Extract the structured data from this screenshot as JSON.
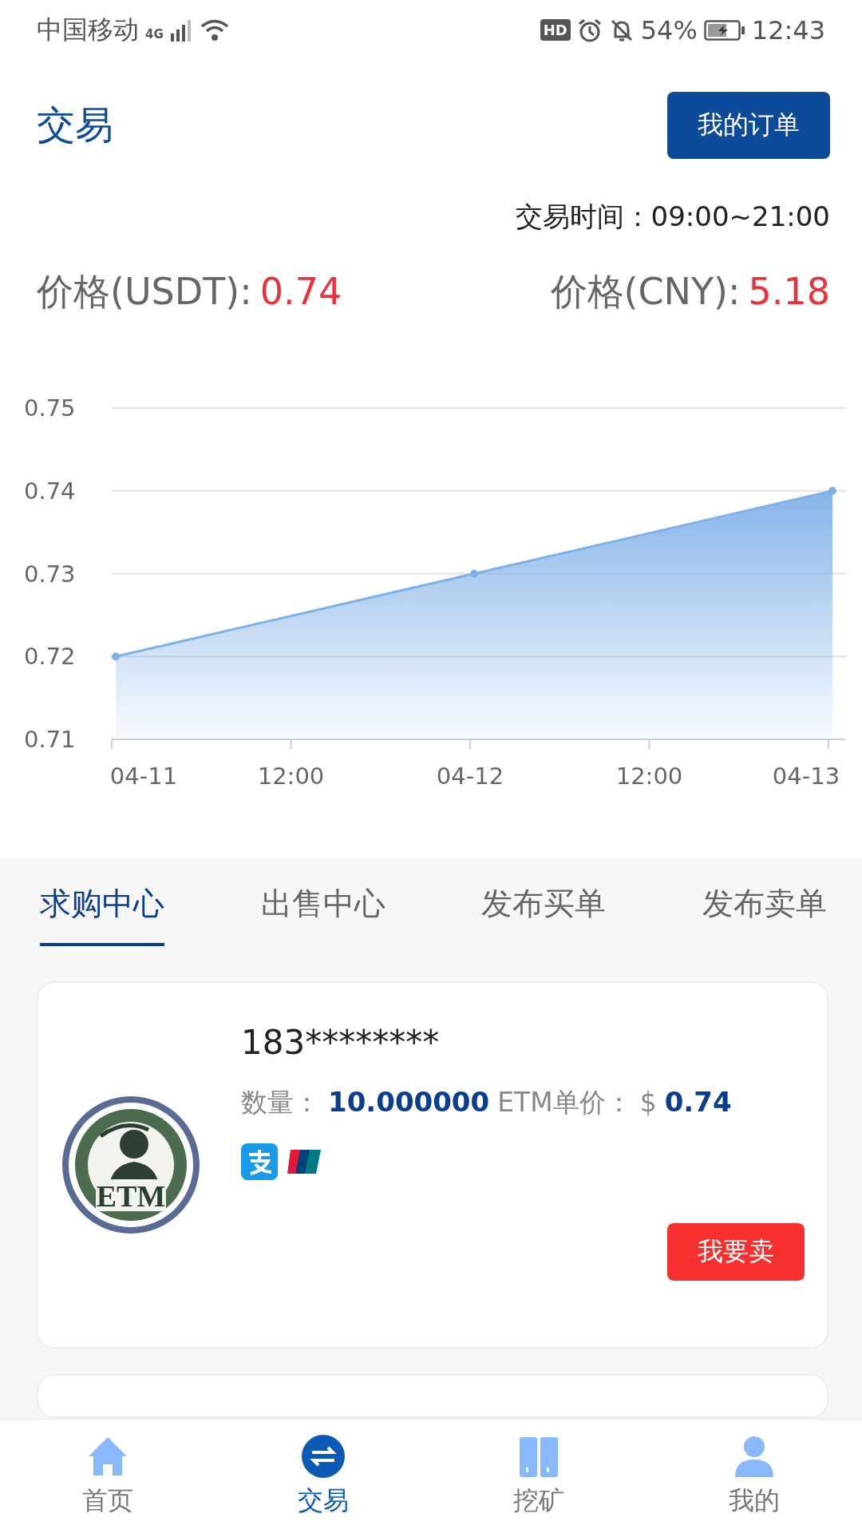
{
  "status_bar": {
    "carrier": "中国移动",
    "network": "4G",
    "hd": "HD",
    "battery": "54%",
    "time": "12:43"
  },
  "header": {
    "title": "交易",
    "orders_button": "我的订单"
  },
  "trade_hours": "交易时间：09:00~21:00",
  "prices": [
    {
      "label": "价格(USDT):",
      "value": "0.74"
    },
    {
      "label": "价格(CNY):",
      "value": "5.18"
    }
  ],
  "chart_data": {
    "type": "area",
    "categories": [
      "04-11",
      "12:00",
      "04-12",
      "12:00",
      "04-13"
    ],
    "series": [
      {
        "color": "#7fb0e8",
        "values": [
          0.72,
          null,
          0.73,
          null,
          0.74
        ]
      }
    ],
    "ylim": [
      0.71,
      0.75
    ],
    "yticks": [
      0.71,
      0.72,
      0.73,
      0.74,
      0.75
    ],
    "grid": true
  },
  "tabs": [
    {
      "label": "求购中心",
      "selected": true
    },
    {
      "label": "出售中心",
      "selected": false
    },
    {
      "label": "发布买单",
      "selected": false
    },
    {
      "label": "发布卖单",
      "selected": false
    }
  ],
  "orders": [
    {
      "user": "183********",
      "logo_text": "ETM",
      "qty_label": "数量：",
      "qty": "10.000000",
      "price_label": "ETM单价：",
      "currency": "$",
      "price": "0.74",
      "payments": [
        {
          "kind": "alipay"
        },
        {
          "kind": "unionpay"
        }
      ],
      "action": "我要卖"
    }
  ],
  "nav": [
    {
      "label": "首页",
      "kind": "home",
      "selected": false
    },
    {
      "label": "交易",
      "kind": "exchange",
      "selected": true
    },
    {
      "label": "挖矿",
      "kind": "mine",
      "selected": false
    },
    {
      "label": "我的",
      "kind": "user",
      "selected": false
    }
  ]
}
